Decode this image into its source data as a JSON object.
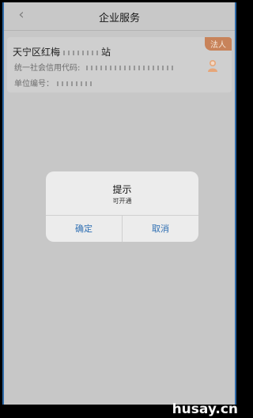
{
  "header": {
    "back_icon": "chevron-left-icon",
    "title": "企业服务"
  },
  "card": {
    "company_name": "天宁区红梅",
    "company_name_tail": "站",
    "credit_code_label": "统一社会信用代码: ",
    "unit_no_label": "单位编号：",
    "badge": "法人",
    "avatar_icon": "person-icon"
  },
  "dialog": {
    "title": "提示",
    "message": "可开通",
    "confirm_label": "确定",
    "cancel_label": "取消"
  },
  "watermark": {
    "text": "husay.cn"
  },
  "colors": {
    "overlay_background": "#c7c7c7",
    "badge": "#c8835a",
    "link_blue": "#2f6fb3",
    "frame_edge": "#2d69a8"
  }
}
